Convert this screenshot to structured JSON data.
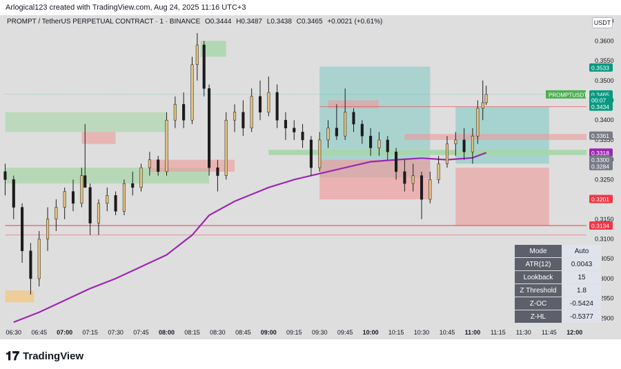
{
  "header": {
    "created_by": "Arlogical123 created with TradingView.com, Aug 24, 2025 11:16 UTC+3"
  },
  "symbol": {
    "name": "PROMPT / TetherUS PERPETUAL CONTRACT · 1 · BINANCE",
    "open": "O0.3444",
    "high": "H0.3487",
    "low": "L0.3438",
    "close": "C0.3465",
    "change": "+0.0021 (+0.61%)"
  },
  "currency_badge": "USDT",
  "logo": {
    "name": "TradingView"
  },
  "chart_data": {
    "type": "candlestick",
    "x_ticks": [
      "06:30",
      "06:45",
      "07:00",
      "07:15",
      "07:30",
      "07:45",
      "08:00",
      "08:15",
      "08:30",
      "08:45",
      "09:00",
      "09:15",
      "09:30",
      "09:45",
      "10:00",
      "10:15",
      "10:30",
      "10:45",
      "11:00",
      "11:15",
      "11:30",
      "11:45",
      "12:00"
    ],
    "x_ticks_bold": [
      "07:00",
      "08:00",
      "09:00",
      "10:00",
      "11:00",
      "12:00"
    ],
    "y_ticks": [
      0.29,
      0.295,
      0.3,
      0.305,
      0.31,
      0.315,
      0.325,
      0.33,
      0.335,
      0.34,
      0.345,
      0.35,
      0.355,
      0.36,
      0.365
    ],
    "ylim": [
      0.2885,
      0.3665
    ],
    "xlim": [
      "06:24",
      "12:07"
    ],
    "price_labels": [
      {
        "value": "0.3533",
        "color": "#089981"
      },
      {
        "value": "PROMPTUSDT.P",
        "color": "#4caf50",
        "price": 0.3465
      },
      {
        "value": "0.3465",
        "color": "#089981"
      },
      {
        "value": "00:07",
        "color": "#089981"
      },
      {
        "value": "0.3434",
        "color": "#089981"
      },
      {
        "value": "0.3361",
        "color": "#787b86"
      },
      {
        "value": "0.3318",
        "color": "#9c27b0"
      },
      {
        "value": "0.3300",
        "color": "#787b86"
      },
      {
        "value": "0.3284",
        "color": "#787b86"
      },
      {
        "value": "0.3201",
        "color": "#f23645"
      },
      {
        "value": "0.3134",
        "color": "#f23645"
      }
    ],
    "moving_average": {
      "color": "#9c27b0",
      "points": [
        [
          "06:30",
          0.289
        ],
        [
          "06:45",
          0.2915
        ],
        [
          "07:00",
          0.2945
        ],
        [
          "07:15",
          0.2975
        ],
        [
          "07:30",
          0.3
        ],
        [
          "07:45",
          0.303
        ],
        [
          "08:00",
          0.306
        ],
        [
          "08:15",
          0.311
        ],
        [
          "08:25",
          0.316
        ],
        [
          "08:40",
          0.3195
        ],
        [
          "09:00",
          0.323
        ],
        [
          "09:15",
          0.325
        ],
        [
          "09:30",
          0.3265
        ],
        [
          "09:45",
          0.328
        ],
        [
          "10:00",
          0.3295
        ],
        [
          "10:15",
          0.33
        ],
        [
          "10:30",
          0.3304
        ],
        [
          "10:45",
          0.33
        ],
        [
          "11:00",
          0.3305
        ],
        [
          "11:08",
          0.3318
        ]
      ]
    },
    "ohlc": [
      [
        "06:25",
        0.327,
        0.329,
        0.321,
        0.325
      ],
      [
        "06:30",
        0.325,
        0.326,
        0.315,
        0.318
      ],
      [
        "06:35",
        0.318,
        0.319,
        0.304,
        0.307
      ],
      [
        "06:40",
        0.307,
        0.309,
        0.296,
        0.3
      ],
      [
        "06:45",
        0.3,
        0.312,
        0.298,
        0.31
      ],
      [
        "06:50",
        0.31,
        0.318,
        0.307,
        0.315
      ],
      [
        "06:55",
        0.315,
        0.32,
        0.312,
        0.318
      ],
      [
        "07:00",
        0.318,
        0.323,
        0.315,
        0.322
      ],
      [
        "07:05",
        0.322,
        0.325,
        0.317,
        0.319
      ],
      [
        "07:10",
        0.319,
        0.328,
        0.318,
        0.326
      ],
      [
        "07:12",
        0.326,
        0.339,
        0.323,
        0.323
      ],
      [
        "07:15",
        0.323,
        0.324,
        0.311,
        0.314
      ],
      [
        "07:20",
        0.314,
        0.32,
        0.311,
        0.319
      ],
      [
        "07:25",
        0.319,
        0.323,
        0.317,
        0.321
      ],
      [
        "07:30",
        0.321,
        0.322,
        0.316,
        0.317
      ],
      [
        "07:35",
        0.317,
        0.325,
        0.316,
        0.324
      ],
      [
        "07:40",
        0.324,
        0.327,
        0.321,
        0.323
      ],
      [
        "07:45",
        0.323,
        0.329,
        0.322,
        0.328
      ],
      [
        "07:50",
        0.328,
        0.332,
        0.326,
        0.33
      ],
      [
        "07:55",
        0.33,
        0.331,
        0.326,
        0.327
      ],
      [
        "08:00",
        0.327,
        0.342,
        0.326,
        0.34
      ],
      [
        "08:05",
        0.34,
        0.346,
        0.338,
        0.344
      ],
      [
        "08:10",
        0.344,
        0.347,
        0.338,
        0.34
      ],
      [
        "08:15",
        0.34,
        0.356,
        0.339,
        0.354
      ],
      [
        "08:18",
        0.354,
        0.362,
        0.35,
        0.359
      ],
      [
        "08:22",
        0.359,
        0.36,
        0.346,
        0.348
      ],
      [
        "08:25",
        0.348,
        0.349,
        0.326,
        0.328
      ],
      [
        "08:30",
        0.328,
        0.33,
        0.322,
        0.326
      ],
      [
        "08:35",
        0.326,
        0.342,
        0.325,
        0.34
      ],
      [
        "08:40",
        0.34,
        0.344,
        0.337,
        0.342
      ],
      [
        "08:45",
        0.342,
        0.345,
        0.336,
        0.338
      ],
      [
        "08:50",
        0.338,
        0.348,
        0.337,
        0.346
      ],
      [
        "08:55",
        0.346,
        0.35,
        0.34,
        0.342
      ],
      [
        "09:00",
        0.342,
        0.351,
        0.341,
        0.347
      ],
      [
        "09:05",
        0.347,
        0.349,
        0.338,
        0.34
      ],
      [
        "09:10",
        0.34,
        0.342,
        0.335,
        0.338
      ],
      [
        "09:15",
        0.338,
        0.34,
        0.335,
        0.337
      ],
      [
        "09:20",
        0.337,
        0.339,
        0.333,
        0.335
      ],
      [
        "09:25",
        0.335,
        0.336,
        0.326,
        0.328
      ],
      [
        "09:30",
        0.328,
        0.337,
        0.327,
        0.335
      ],
      [
        "09:35",
        0.335,
        0.34,
        0.333,
        0.338
      ],
      [
        "09:40",
        0.338,
        0.344,
        0.335,
        0.336
      ],
      [
        "09:45",
        0.336,
        0.348,
        0.335,
        0.342
      ],
      [
        "09:50",
        0.342,
        0.343,
        0.337,
        0.339
      ],
      [
        "09:55",
        0.339,
        0.34,
        0.334,
        0.336
      ],
      [
        "10:00",
        0.336,
        0.338,
        0.331,
        0.333
      ],
      [
        "10:05",
        0.333,
        0.337,
        0.331,
        0.335
      ],
      [
        "10:10",
        0.335,
        0.336,
        0.33,
        0.332
      ],
      [
        "10:15",
        0.332,
        0.333,
        0.325,
        0.327
      ],
      [
        "10:20",
        0.327,
        0.33,
        0.322,
        0.324
      ],
      [
        "10:25",
        0.324,
        0.329,
        0.322,
        0.326
      ],
      [
        "10:30",
        0.326,
        0.327,
        0.315,
        0.32
      ],
      [
        "10:35",
        0.32,
        0.327,
        0.319,
        0.325
      ],
      [
        "10:40",
        0.325,
        0.331,
        0.324,
        0.329
      ],
      [
        "10:45",
        0.329,
        0.336,
        0.328,
        0.334
      ],
      [
        "10:50",
        0.334,
        0.337,
        0.331,
        0.335
      ],
      [
        "10:55",
        0.335,
        0.338,
        0.33,
        0.332
      ],
      [
        "11:00",
        0.332,
        0.338,
        0.329,
        0.336
      ],
      [
        "11:03",
        0.336,
        0.345,
        0.334,
        0.343
      ],
      [
        "11:06",
        0.343,
        0.35,
        0.34,
        0.3444
      ],
      [
        "11:08",
        0.3444,
        0.3487,
        0.3438,
        0.3465
      ]
    ]
  }
}
